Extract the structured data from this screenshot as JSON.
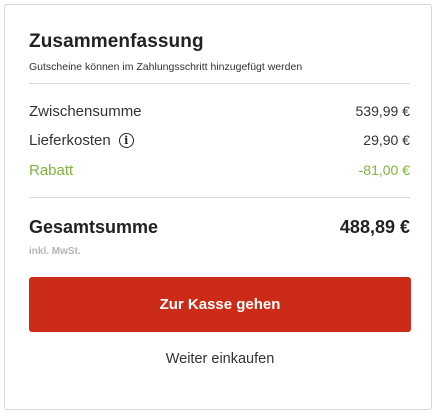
{
  "summary": {
    "title": "Zusammenfassung",
    "subtitle": "Gutscheine können im Zahlungsschritt hinzugefügt werden",
    "subtotal_label": "Zwischensumme",
    "subtotal_value": "539,99 €",
    "shipping_label": "Lieferkosten",
    "shipping_info_icon": "info-icon",
    "shipping_value": "29,90 €",
    "discount_label": "Rabatt",
    "discount_value": "-81,00 €",
    "total_label": "Gesamtsumme",
    "total_value": "488,89 €",
    "vat_note": "inkl. MwSt.",
    "checkout_label": "Zur Kasse gehen",
    "continue_label": "Weiter einkaufen"
  },
  "colors": {
    "checkout_button": "#cc2c17",
    "discount": "#80b43c"
  }
}
